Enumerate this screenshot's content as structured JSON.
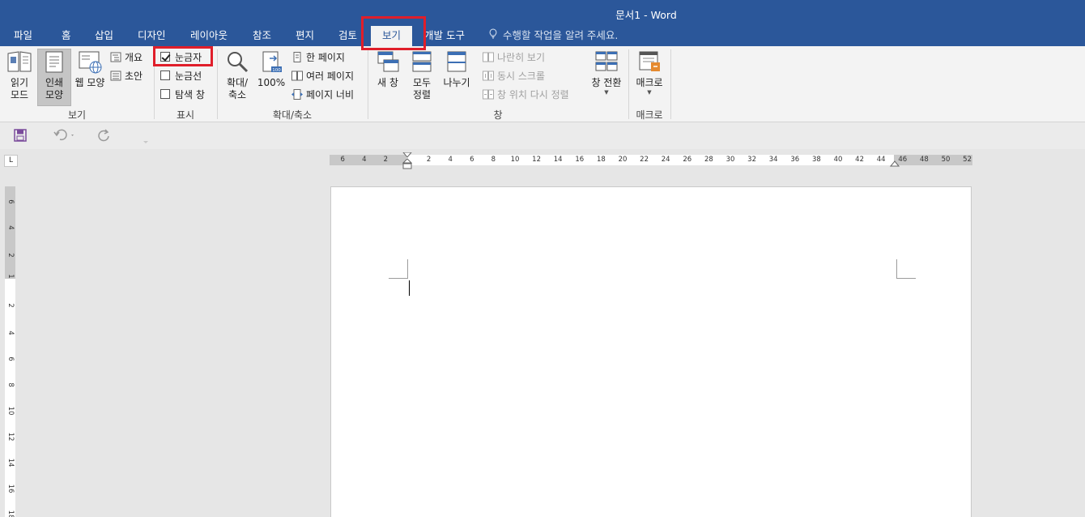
{
  "window": {
    "title": "문서1 - Word"
  },
  "tabs": [
    {
      "label": "파일"
    },
    {
      "label": "홈"
    },
    {
      "label": "삽입"
    },
    {
      "label": "디자인"
    },
    {
      "label": "레이아웃"
    },
    {
      "label": "참조"
    },
    {
      "label": "편지"
    },
    {
      "label": "검토"
    },
    {
      "label": "보기"
    },
    {
      "label": "개발 도구"
    }
  ],
  "active_tab": "보기",
  "tell_me": "수행할 작업을 알려 주세요.",
  "ribbon": {
    "views": {
      "label": "보기",
      "read_mode": "읽기\n모드",
      "read_mode_l1": "읽기",
      "read_mode_l2": "모드",
      "print_layout_l1": "인쇄",
      "print_layout_l2": "모양",
      "web_layout": "웹 모양",
      "outline": "개요",
      "draft": "초안"
    },
    "show": {
      "label": "표시",
      "ruler": "눈금자",
      "ruler_checked": true,
      "gridlines": "눈금선",
      "gridlines_checked": false,
      "nav_pane": "탐색 창",
      "nav_pane_checked": false
    },
    "zoom": {
      "label": "확대/축소",
      "zoom_l1": "확대/",
      "zoom_l2": "축소",
      "percent100": "100%",
      "one_page": "한 페이지",
      "multiple_pages": "여러 페이지",
      "page_width": "페이지 너비"
    },
    "window": {
      "label": "창",
      "new_window": "새 창",
      "arrange_all_l1": "모두",
      "arrange_all_l2": "정렬",
      "split": "나누기",
      "side_by_side": "나란히 보기",
      "sync_scroll": "동시 스크롤",
      "reset_position": "창 위치 다시 정렬",
      "switch_windows": "창 전환"
    },
    "macros": {
      "label": "매크로",
      "macros": "매크로"
    }
  },
  "ruler": {
    "horizontal_ticks": [
      "6",
      "4",
      "2",
      "2",
      "4",
      "6",
      "8",
      "10",
      "12",
      "14",
      "16",
      "18",
      "20",
      "22",
      "24",
      "26",
      "28",
      "30",
      "32",
      "34",
      "36",
      "38",
      "40",
      "42",
      "44",
      "46",
      "48",
      "50",
      "52"
    ],
    "vertical_ticks": [
      "6",
      "4",
      "2",
      "1",
      "2",
      "4",
      "6",
      "8",
      "10",
      "12",
      "14",
      "16",
      "18"
    ],
    "corner_symbol": "L"
  },
  "colors": {
    "titlebar": "#2b579a",
    "ribbon": "#f3f3f3",
    "highlight": "#e01e2a"
  }
}
